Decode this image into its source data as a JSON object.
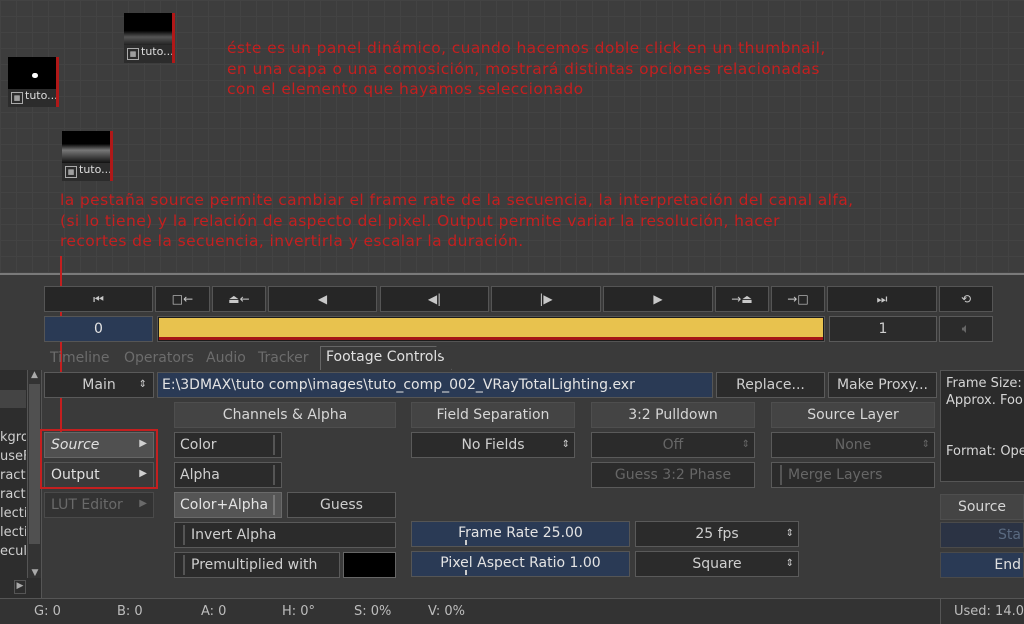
{
  "graph": {
    "nodes": [
      {
        "label": "tuto..."
      },
      {
        "label": "tuto..."
      },
      {
        "label": "tuto..."
      }
    ],
    "annotation1": "éste es un panel dinámico, cuando hacemos doble click en un thumbnail,\nen una capa o una comosición, mostrará distintas opciones relacionadas\ncon el elemento que hayamos seleccionado",
    "annotation2": "la pestaña source permite cambiar el frame rate de la secuencia, la interpretación del canal alfa,\n(si lo tiene) y la relación de aspecto del pixel. Output permite variar la resolución, hacer\nrecortes de la secuencia, invertirla y escalar la duración."
  },
  "transport": {
    "icons": [
      "skip-to-start-icon",
      "prev-key-icon",
      "prev-marker-icon",
      "step-back-icon",
      "prev-frame-icon",
      "next-frame-icon",
      "play-icon",
      "next-marker-icon",
      "next-key-icon",
      "skip-to-end-icon",
      "loop-icon"
    ],
    "glyphs": [
      "⏮",
      "□←",
      "⏏←",
      "◀",
      "◀|",
      "|▶",
      "▶",
      "→⏏",
      "→□",
      "⏭",
      "⟲"
    ],
    "current_frame": "0",
    "end_frame": "1",
    "timeline_color": "#e8c24e"
  },
  "tabs": [
    "Timeline",
    "Operators",
    "Audio",
    "Tracker",
    "Footage Controls"
  ],
  "left_list": [
    "kgro",
    "useF",
    "ract",
    "ract",
    "lecti",
    "lecti",
    "ecula"
  ],
  "footage": {
    "view_select": "Main",
    "path": "E:\\3DMAX\\tuto comp\\images\\tuto_comp_002_VRayTotalLighting.exr",
    "replace_label": "Replace...",
    "proxy_label": "Make Proxy...",
    "side_tabs": [
      "Source",
      "Output",
      "LUT Editor"
    ],
    "channels": {
      "header": "Channels & Alpha",
      "color": "Color",
      "alpha": "Alpha",
      "color_alpha": "Color+Alpha",
      "guess": "Guess",
      "invert_alpha": "Invert Alpha",
      "premultiplied": "Premultiplied with"
    },
    "field": {
      "header": "Field Separation",
      "value": "No Fields"
    },
    "pulldown": {
      "header": "3:2 Pulldown",
      "value": "Off",
      "guess": "Guess 3:2 Phase"
    },
    "source_layer": {
      "header": "Source Layer",
      "value": "None",
      "merge": "Merge Layers"
    },
    "frame_rate": {
      "label": "Frame Rate 25.00",
      "select": "25 fps"
    },
    "pixel_aspect": {
      "label": "Pixel Aspect Ratio 1.00",
      "select": "Square"
    }
  },
  "info": {
    "frame_size": "Frame Size:",
    "approx": "Approx. Foo",
    "format": "Format: Ope",
    "source_btn": "Source",
    "start": "Sta",
    "end": "End"
  },
  "status": {
    "g": "G: 0",
    "b": "B: 0",
    "a": "A: 0",
    "h": "H: 0°",
    "s": "S: 0%",
    "v": "V: 0%",
    "used": "Used: 14.0"
  }
}
